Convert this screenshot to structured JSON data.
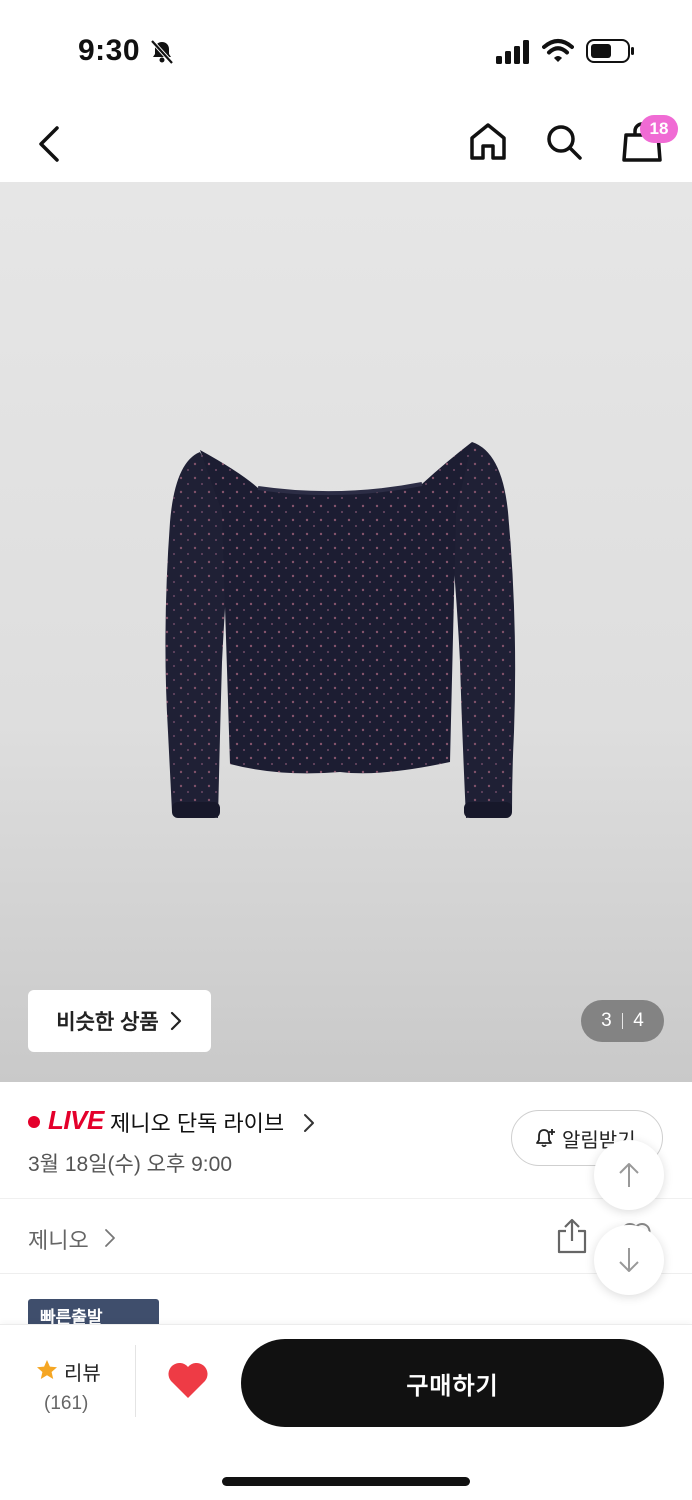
{
  "status_bar": {
    "time": "9:30",
    "icons": [
      "bell-off-icon",
      "cellular-signal-icon",
      "wifi-icon",
      "battery-icon"
    ]
  },
  "nav": {
    "icons": [
      "back-chevron-icon",
      "home-icon",
      "search-icon",
      "shopping-bag-icon"
    ],
    "cart_count": "18",
    "badge_color": "#f06bd4"
  },
  "product_image": {
    "similar_button_label": "비슷한 상품",
    "page_current": "3",
    "page_total": "4"
  },
  "live": {
    "label": "LIVE",
    "title": "제니오 단독 라이브",
    "date": "3월 18일(수) 오후 9:00",
    "alarm_label": "알림받기",
    "accent_color": "#e4002b"
  },
  "brand": {
    "name": "제니오"
  },
  "badge": {
    "label": "빠른출발"
  },
  "bottom_bar": {
    "review_label": "리뷰",
    "review_count": "(161)",
    "buy_label": "구매하기",
    "heart_color": "#ee3b45"
  }
}
